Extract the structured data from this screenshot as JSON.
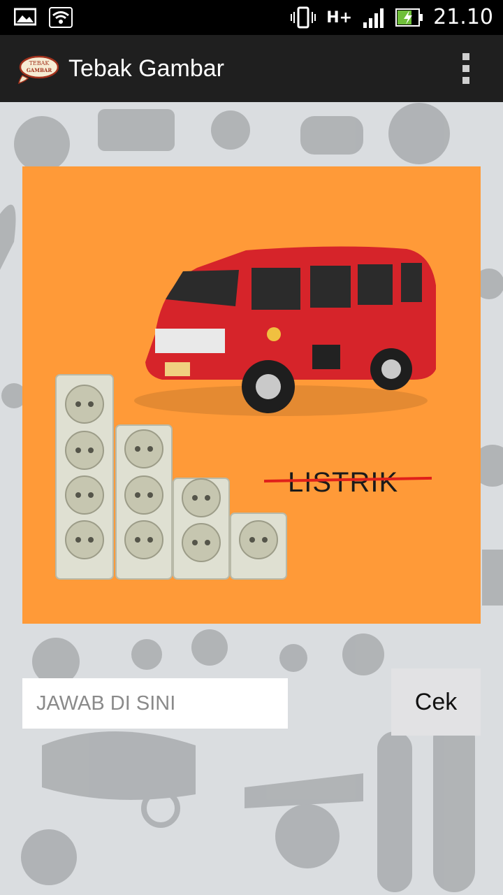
{
  "status_bar": {
    "network_type": "H+",
    "time": "21.10",
    "icons": [
      "image-icon",
      "wifi-icon",
      "vibrate-icon",
      "signal-icon",
      "battery-charging-icon"
    ]
  },
  "action_bar": {
    "logo_text_top": "TEBAK",
    "logo_text_bottom": "GAMBAR",
    "title": "Tebak Gambar",
    "menu_icon": "overflow-menu-icon"
  },
  "puzzle": {
    "background_color": "#ff9a38",
    "crossed_word": "LISTRIK",
    "strike_color": "#e0201a"
  },
  "answer": {
    "placeholder": "JAWAB DI SINI",
    "value": ""
  },
  "check_button": {
    "label": "Cek"
  }
}
